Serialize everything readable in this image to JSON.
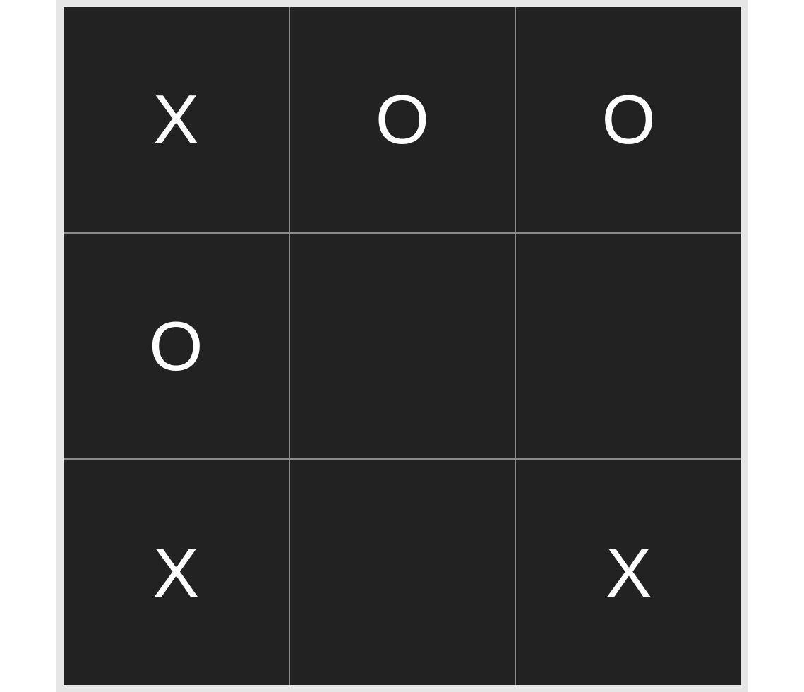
{
  "colors": {
    "frame": "#e6e6e6",
    "cell": "#222222",
    "grid_line": "#8a8a8a",
    "mark": "#ffffff"
  },
  "board": {
    "cells": [
      "X",
      "O",
      "O",
      "O",
      "",
      "",
      "X",
      "",
      "X"
    ]
  }
}
